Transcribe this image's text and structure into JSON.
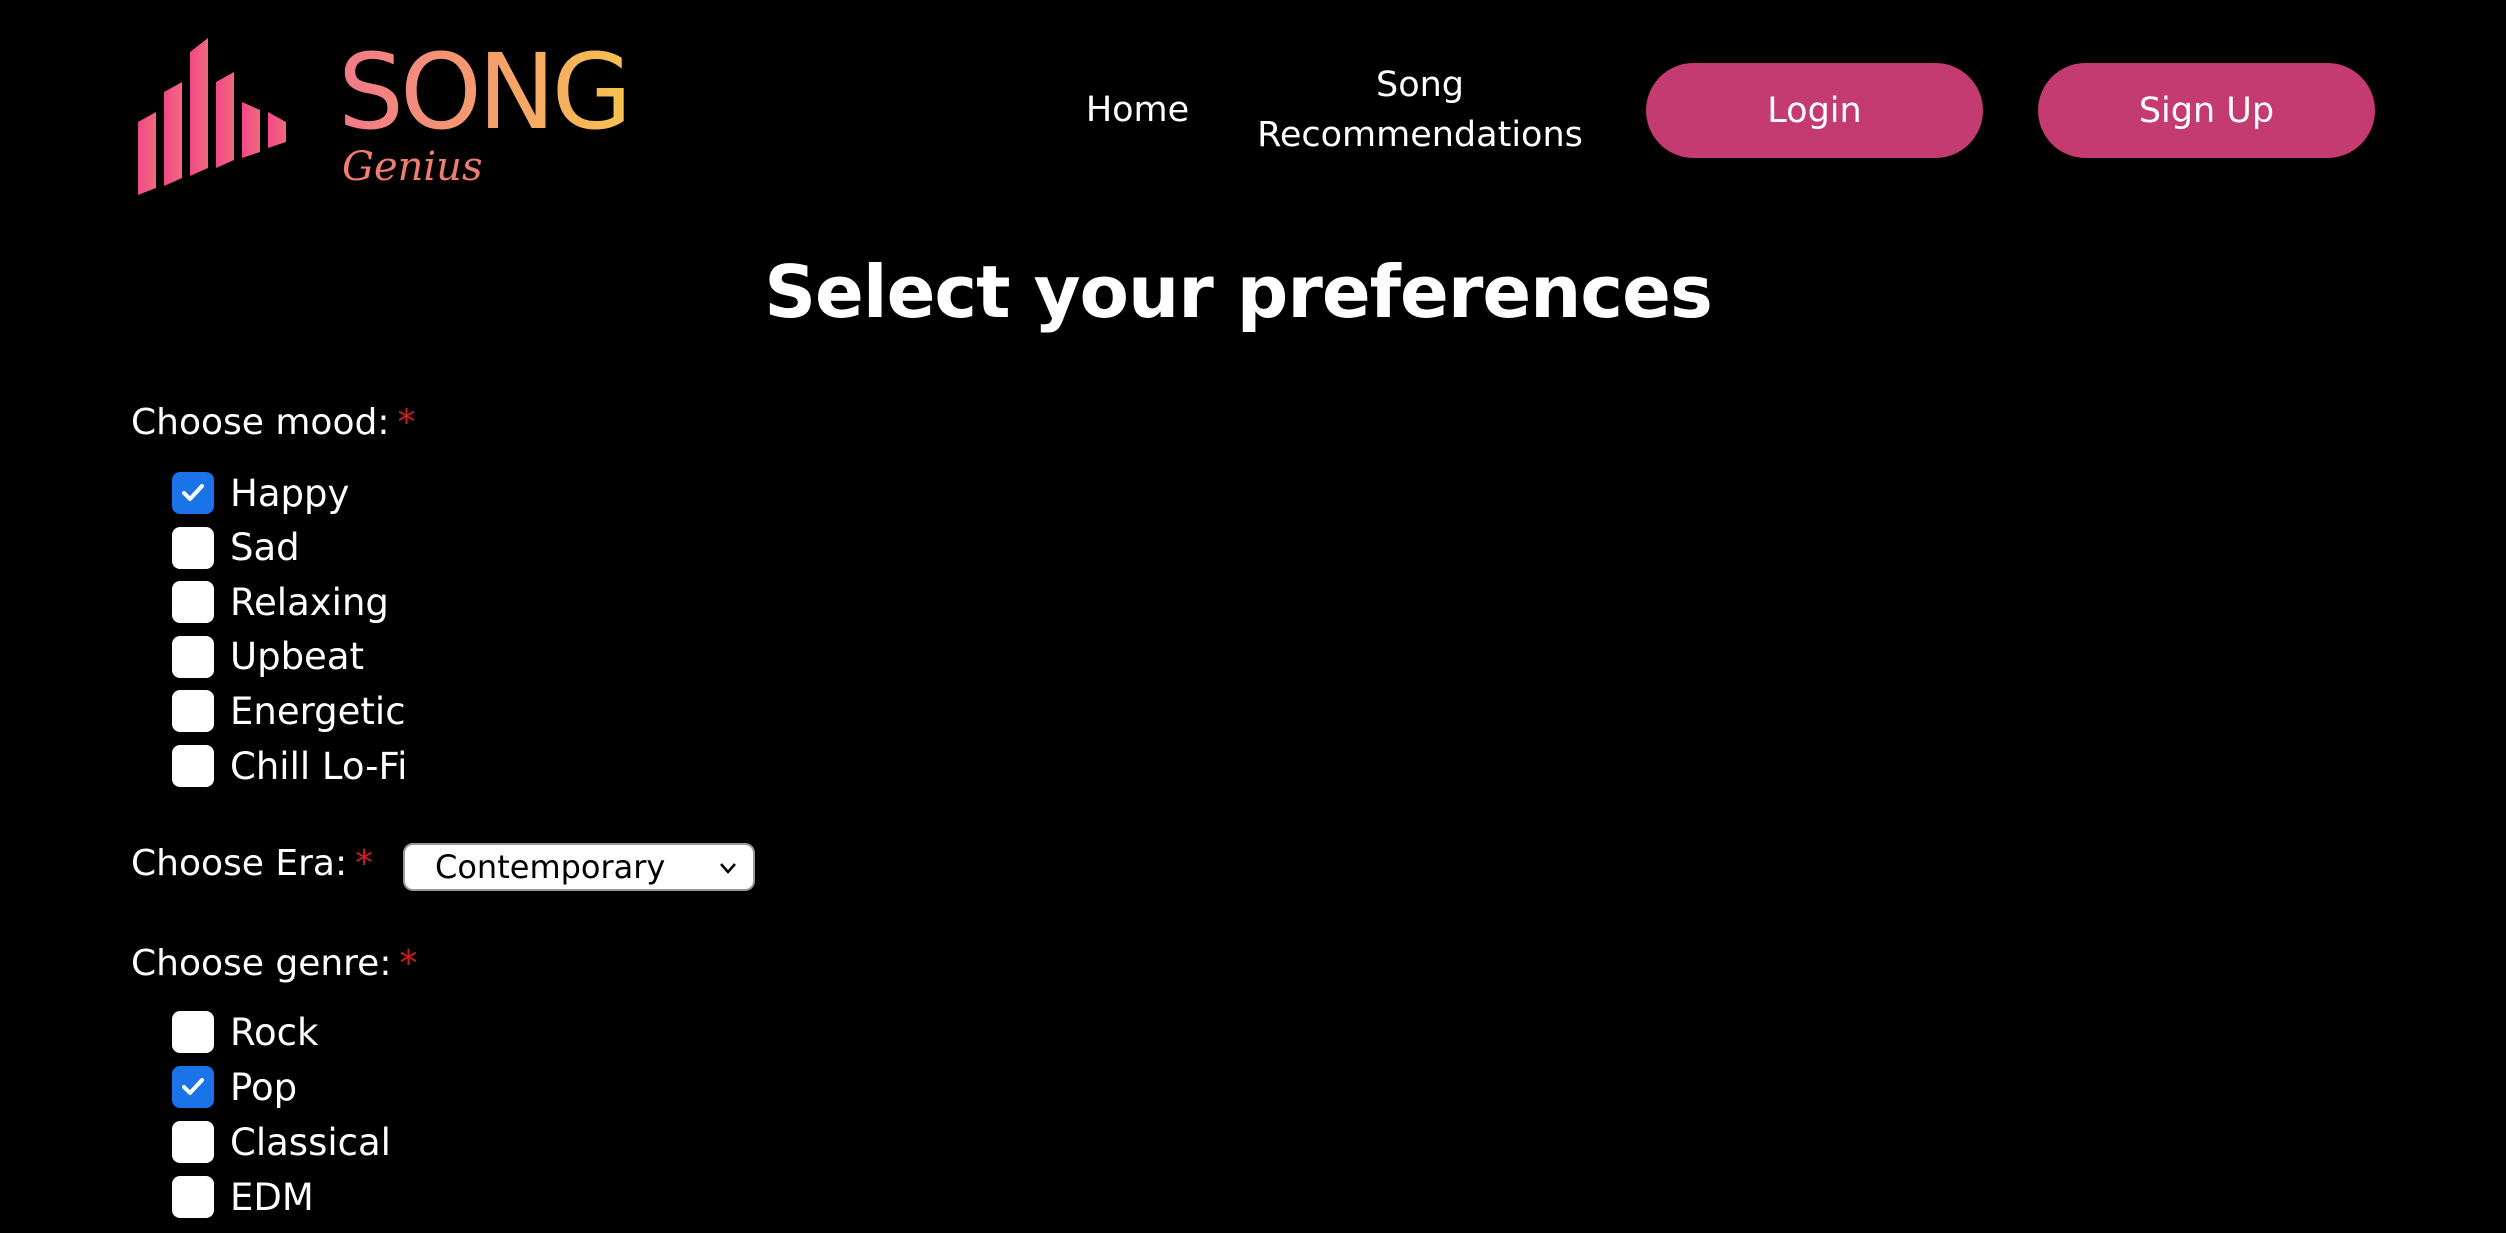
{
  "brand": {
    "word": "SONG",
    "sub": "Genius"
  },
  "nav": {
    "home": "Home",
    "recommendations": "Song\nRecommendations"
  },
  "auth": {
    "login": "Login",
    "signup": "Sign Up"
  },
  "page": {
    "title": "Select your preferences"
  },
  "mood": {
    "label": "Choose mood:",
    "required": "*",
    "options": [
      {
        "label": "Happy",
        "checked": true
      },
      {
        "label": "Sad",
        "checked": false
      },
      {
        "label": "Relaxing",
        "checked": false
      },
      {
        "label": "Upbeat",
        "checked": false
      },
      {
        "label": "Energetic",
        "checked": false
      },
      {
        "label": "Chill Lo-Fi",
        "checked": false
      }
    ]
  },
  "era": {
    "label": "Choose Era:",
    "required": "*",
    "selected": "Contemporary"
  },
  "genre": {
    "label": "Choose genre:",
    "required": "*",
    "options": [
      {
        "label": "Rock",
        "checked": false
      },
      {
        "label": "Pop",
        "checked": true
      },
      {
        "label": "Classical",
        "checked": false
      },
      {
        "label": "EDM",
        "checked": false
      }
    ]
  },
  "colors": {
    "accent": "#c43b71",
    "checkbox": "#1a73e8",
    "required": "#cc1f1f",
    "background": "#000000"
  },
  "icons": {
    "logo": "equalizer-bars-icon",
    "select": "chevron-down-icon",
    "check": "checkmark-icon"
  }
}
